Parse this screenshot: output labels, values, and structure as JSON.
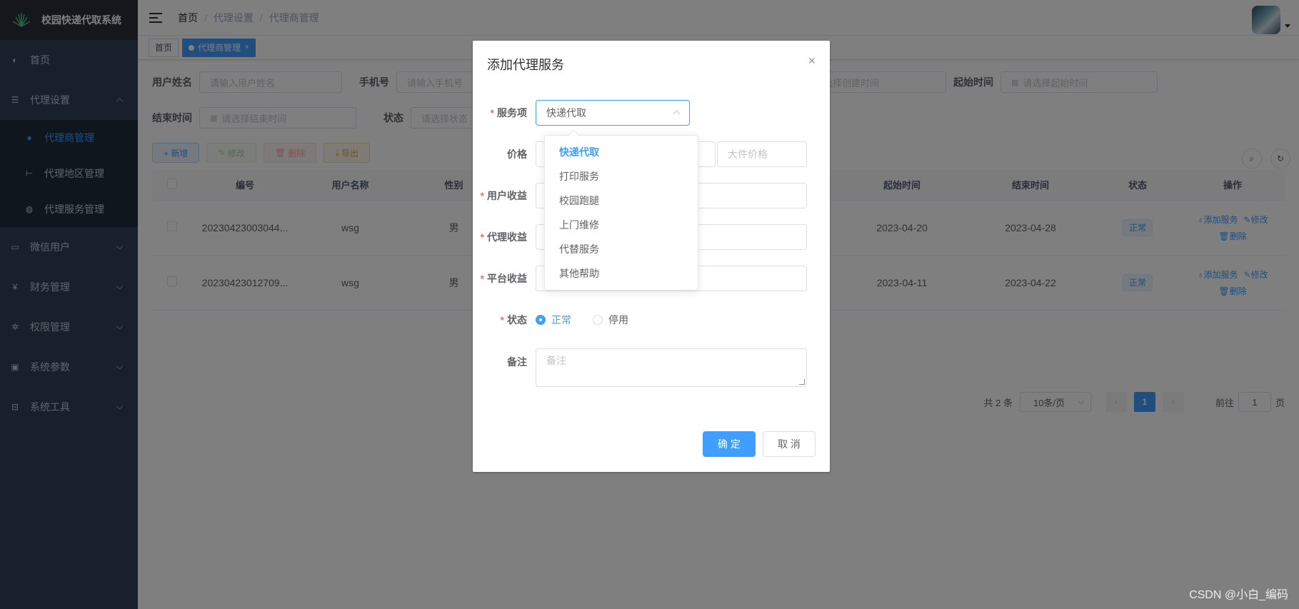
{
  "app": {
    "title": "校园快递代取系统"
  },
  "sidebar": {
    "items": [
      {
        "label": "首页",
        "icon": "dashboard-icon"
      },
      {
        "label": "代理设置",
        "icon": "settings-sliders-icon",
        "expanded": true,
        "children": [
          {
            "label": "代理商管理",
            "icon": "user-icon",
            "active": true
          },
          {
            "label": "代理地区管理",
            "icon": "tree-icon"
          },
          {
            "label": "代理服务管理",
            "icon": "globe-icon"
          }
        ]
      },
      {
        "label": "微信用户",
        "icon": "monitor-icon"
      },
      {
        "label": "财务管理",
        "icon": "yen-icon"
      },
      {
        "label": "权限管理",
        "icon": "gear-icon"
      },
      {
        "label": "系统参数",
        "icon": "display-icon"
      },
      {
        "label": "系统工具",
        "icon": "toolbox-icon"
      }
    ]
  },
  "navbar": {
    "breadcrumb": [
      "首页",
      "代理设置",
      "代理商管理"
    ]
  },
  "tags": [
    {
      "label": "首页"
    },
    {
      "label": "代理商管理",
      "active": true
    }
  ],
  "search": {
    "username_label": "用户姓名",
    "username_placeholder": "请输入用户姓名",
    "phone_label": "手机号",
    "phone_placeholder": "请输入手机号",
    "created_placeholder": "请选择创建时间",
    "start_label": "起始时间",
    "start_placeholder": "请选择起始时间",
    "end_label": "结束时间",
    "end_placeholder": "请选择结束时间",
    "status_label": "状态",
    "status_placeholder": "请选择状态"
  },
  "toolbar": {
    "add": "+ 新增",
    "edit": "修改",
    "delete": "删除",
    "export": "导出"
  },
  "table": {
    "headers": [
      "编号",
      "用户名称",
      "性别",
      "起始时间",
      "结束时间",
      "状态",
      "操作"
    ],
    "rows": [
      {
        "id": "20230423003044...",
        "name": "wsg",
        "gender": "男",
        "start": "2023-04-20",
        "end": "2023-04-28",
        "status": "正常"
      },
      {
        "id": "20230423012709...",
        "name": "wsg",
        "gender": "男",
        "start": "2023-04-11",
        "end": "2023-04-22",
        "status": "正常"
      }
    ],
    "ops": {
      "add_service": "添加服务",
      "edit": "修改",
      "delete": "删除"
    }
  },
  "pagination": {
    "total": "共 2 条",
    "page_size": "10条/页",
    "current": "1",
    "goto_prefix": "前往",
    "goto_value": "1",
    "goto_suffix": "页"
  },
  "dialog": {
    "title": "添加代理服务",
    "service_label": "服务项",
    "service_value": "快递代取",
    "price_label": "价格",
    "large_price_placeholder": "大件价格",
    "user_income_label": "用户收益",
    "agent_income_label": "代理收益",
    "platform_income_label": "平台收益",
    "status_label": "状态",
    "status_normal": "正常",
    "status_disabled": "停用",
    "remark_label": "备注",
    "remark_placeholder": "备注",
    "confirm": "确 定",
    "cancel": "取 消"
  },
  "dropdown": {
    "options": [
      "快递代取",
      "打印服务",
      "校园跑腿",
      "上门维修",
      "代替服务",
      "其他帮助"
    ],
    "selected": "快递代取"
  },
  "watermark": "CSDN @小白_编码",
  "colors": {
    "primary": "#409eff",
    "sidebar": "#304156",
    "danger": "#f56c6c"
  }
}
